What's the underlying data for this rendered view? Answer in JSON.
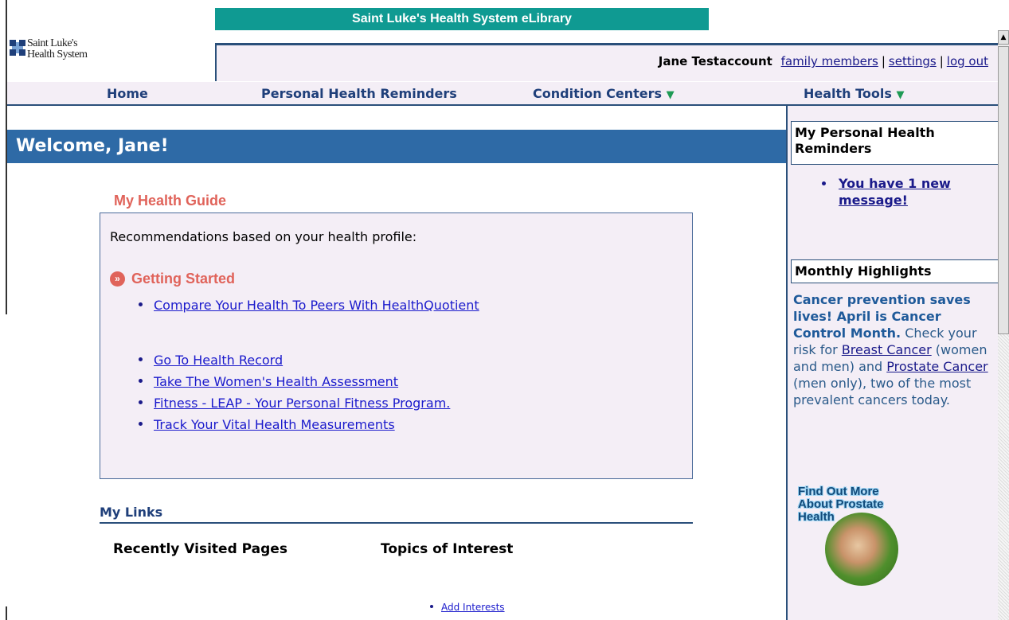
{
  "window": {
    "title": "Saint Luke's Health System eLibrary"
  },
  "logo": {
    "line1": "Saint Luke's",
    "line2": "Health System"
  },
  "user": {
    "name": "Jane Testaccount",
    "links": [
      "family members",
      "settings",
      "log out"
    ]
  },
  "nav": {
    "items": [
      {
        "label": "Home",
        "dropdown": false
      },
      {
        "label": "Personal Health Reminders",
        "dropdown": false
      },
      {
        "label": "Condition Centers",
        "dropdown": true
      },
      {
        "label": "Health Tools",
        "dropdown": true
      }
    ]
  },
  "welcome": "Welcome, Jane!",
  "health_guide": {
    "title": "My Health Guide",
    "intro": "Recommendations based on your health profile:",
    "section_title": "Getting Started",
    "links": [
      "Compare Your Health To Peers With HealthQuotient",
      "Go To Health Record",
      "Take The Women's Health Assessment",
      "Fitness - LEAP - Your Personal Fitness Program.",
      "Track Your Vital Health Measurements"
    ]
  },
  "my_links": {
    "title": "My Links",
    "recent_heading": "Recently Visited Pages",
    "topics_heading": "Topics of Interest",
    "add_interests": "Add Interests"
  },
  "sidebar": {
    "reminders_title": "My Personal Health Reminders",
    "reminder_message": "You have 1 new message!",
    "highlights_title": "Monthly Highlights",
    "highlight_bold": "Cancer prevention saves lives! April is Cancer Control Month.",
    "highlight_text_1": "Check your risk for",
    "highlight_link_1": "Breast Cancer",
    "highlight_text_2": "(women and men) and",
    "highlight_link_2": "Prostate Cancer",
    "highlight_text_3": "(men only), two of the most prevalent cancers today.",
    "promo_text": "Find Out More About Prostate Health"
  },
  "colors": {
    "title_bar": "#0f9a92",
    "welcome_bar": "#2e6aa6",
    "accent_red": "#e0635a",
    "nav_text": "#1f3f7a",
    "panel_bg": "#f4eef6"
  }
}
